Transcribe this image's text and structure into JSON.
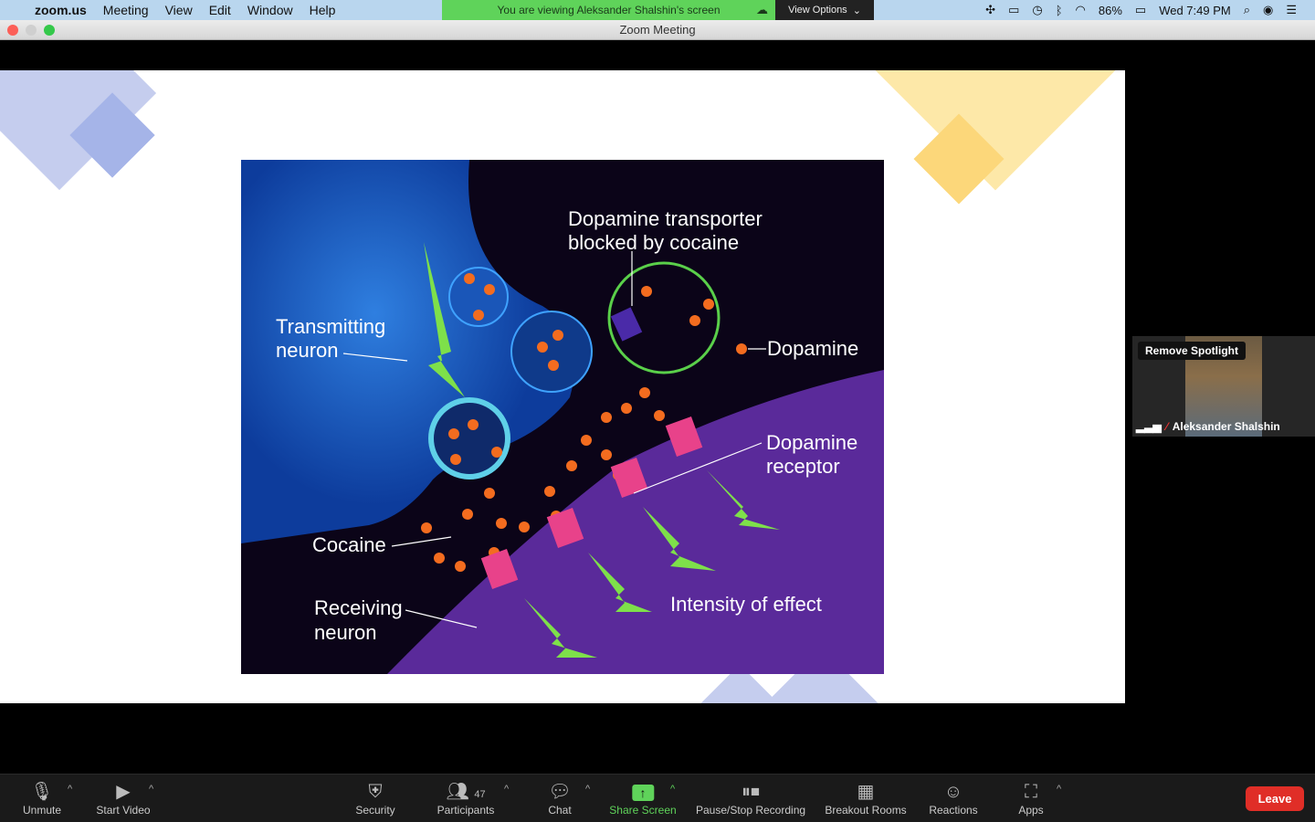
{
  "menubar": {
    "app": "zoom.us",
    "items": [
      "Meeting",
      "View",
      "Edit",
      "Window",
      "Help"
    ],
    "battery": "86%",
    "clock": "Wed 7:49 PM"
  },
  "banner": {
    "text": "You are viewing Aleksander Shalshin's screen",
    "view_options": "View Options"
  },
  "window": {
    "title": "Zoom Meeting"
  },
  "figure": {
    "labels": {
      "transporter_1": "Dopamine transporter",
      "transporter_2": "blocked by cocaine",
      "transmitting_1": "Transmitting",
      "transmitting_2": "neuron",
      "dopamine": "Dopamine",
      "receptor_1": "Dopamine",
      "receptor_2": "receptor",
      "cocaine": "Cocaine",
      "receiving_1": "Receiving",
      "receiving_2": "neuron",
      "intensity": "Intensity of effect"
    }
  },
  "video": {
    "spotlight": "Remove Spotlight",
    "name": "Aleksander Shalshin"
  },
  "toolbar": {
    "unmute": "Unmute",
    "start_video": "Start Video",
    "security": "Security",
    "participants": "Participants",
    "participant_count": "47",
    "chat": "Chat",
    "share_screen": "Share Screen",
    "recording": "Pause/Stop Recording",
    "breakout": "Breakout Rooms",
    "reactions": "Reactions",
    "apps": "Apps",
    "leave": "Leave"
  },
  "colors": {
    "share_green": "#5fd35a",
    "leave_red": "#e02e27"
  }
}
